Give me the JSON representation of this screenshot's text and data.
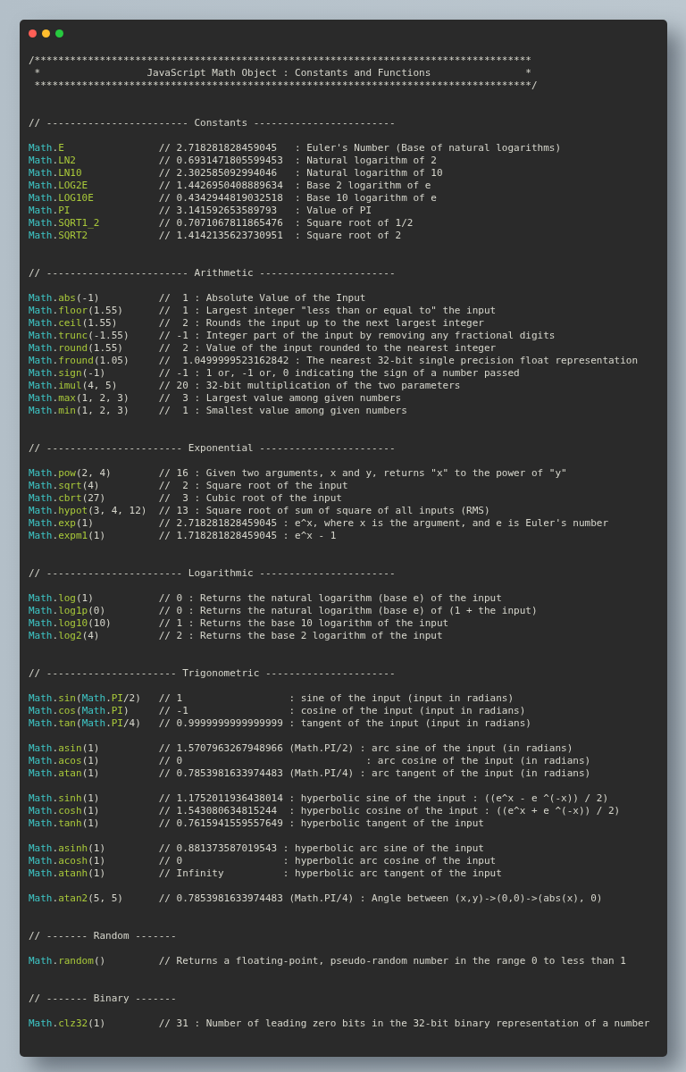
{
  "window": {
    "controls": [
      {
        "kind": "close"
      },
      {
        "kind": "minimize"
      },
      {
        "kind": "maximize"
      }
    ]
  },
  "header": [
    "/************************************************************************************",
    " *                  JavaScript Math Object : Constants and Functions                *",
    " ************************************************************************************/"
  ],
  "sections": [
    {
      "heading": "// ------------------------ Constants ------------------------",
      "groups": [
        [
          {
            "code": [
              {
                "kind": "object",
                "text": "Math"
              },
              {
                "kind": "plain",
                "text": "."
              },
              {
                "kind": "member",
                "text": "E"
              }
            ],
            "comment": "// 2.718281828459045   : Euler's Number (Base of natural logarithms)"
          },
          {
            "code": [
              {
                "kind": "object",
                "text": "Math"
              },
              {
                "kind": "plain",
                "text": "."
              },
              {
                "kind": "member",
                "text": "LN2"
              }
            ],
            "comment": "// 0.6931471805599453  : Natural logarithm of 2"
          },
          {
            "code": [
              {
                "kind": "object",
                "text": "Math"
              },
              {
                "kind": "plain",
                "text": "."
              },
              {
                "kind": "member",
                "text": "LN10"
              }
            ],
            "comment": "// 2.302585092994046   : Natural logarithm of 10"
          },
          {
            "code": [
              {
                "kind": "object",
                "text": "Math"
              },
              {
                "kind": "plain",
                "text": "."
              },
              {
                "kind": "member",
                "text": "LOG2E"
              }
            ],
            "comment": "// 1.4426950408889634  : Base 2 logarithm of e"
          },
          {
            "code": [
              {
                "kind": "object",
                "text": "Math"
              },
              {
                "kind": "plain",
                "text": "."
              },
              {
                "kind": "member",
                "text": "LOG10E"
              }
            ],
            "comment": "// 0.4342944819032518  : Base 10 logarithm of e"
          },
          {
            "code": [
              {
                "kind": "object",
                "text": "Math"
              },
              {
                "kind": "plain",
                "text": "."
              },
              {
                "kind": "member",
                "text": "PI"
              }
            ],
            "comment": "// 3.141592653589793   : Value of PI"
          },
          {
            "code": [
              {
                "kind": "object",
                "text": "Math"
              },
              {
                "kind": "plain",
                "text": "."
              },
              {
                "kind": "member",
                "text": "SQRT1_2"
              }
            ],
            "comment": "// 0.7071067811865476  : Square root of 1/2"
          },
          {
            "code": [
              {
                "kind": "object",
                "text": "Math"
              },
              {
                "kind": "plain",
                "text": "."
              },
              {
                "kind": "member",
                "text": "SQRT2"
              }
            ],
            "comment": "// 1.4142135623730951  : Square root of 2"
          }
        ]
      ]
    },
    {
      "heading": "// ------------------------ Arithmetic -----------------------",
      "groups": [
        [
          {
            "code": [
              {
                "kind": "object",
                "text": "Math"
              },
              {
                "kind": "plain",
                "text": "."
              },
              {
                "kind": "member",
                "text": "abs"
              },
              {
                "kind": "plain",
                "text": "(-1)"
              }
            ],
            "comment": "//  1 : Absolute Value of the Input"
          },
          {
            "code": [
              {
                "kind": "object",
                "text": "Math"
              },
              {
                "kind": "plain",
                "text": "."
              },
              {
                "kind": "member",
                "text": "floor"
              },
              {
                "kind": "plain",
                "text": "(1.55)"
              }
            ],
            "comment": "//  1 : Largest integer \"less than or equal to\" the input"
          },
          {
            "code": [
              {
                "kind": "object",
                "text": "Math"
              },
              {
                "kind": "plain",
                "text": "."
              },
              {
                "kind": "member",
                "text": "ceil"
              },
              {
                "kind": "plain",
                "text": "(1.55)"
              }
            ],
            "comment": "//  2 : Rounds the input up to the next largest integer"
          },
          {
            "code": [
              {
                "kind": "object",
                "text": "Math"
              },
              {
                "kind": "plain",
                "text": "."
              },
              {
                "kind": "member",
                "text": "trunc"
              },
              {
                "kind": "plain",
                "text": "(-1.55)"
              }
            ],
            "comment": "// -1 : Integer part of the input by removing any fractional digits"
          },
          {
            "code": [
              {
                "kind": "object",
                "text": "Math"
              },
              {
                "kind": "plain",
                "text": "."
              },
              {
                "kind": "member",
                "text": "round"
              },
              {
                "kind": "plain",
                "text": "(1.55)"
              }
            ],
            "comment": "//  2 : Value of the input rounded to the nearest integer"
          },
          {
            "code": [
              {
                "kind": "object",
                "text": "Math"
              },
              {
                "kind": "plain",
                "text": "."
              },
              {
                "kind": "member",
                "text": "fround"
              },
              {
                "kind": "plain",
                "text": "(1.05)"
              }
            ],
            "comment": "//  1.0499999523162842 : The nearest 32-bit single precision float representation"
          },
          {
            "code": [
              {
                "kind": "object",
                "text": "Math"
              },
              {
                "kind": "plain",
                "text": "."
              },
              {
                "kind": "member",
                "text": "sign"
              },
              {
                "kind": "plain",
                "text": "(-1)"
              }
            ],
            "comment": "// -1 : 1 or, -1 or, 0 indicating the sign of a number passed"
          },
          {
            "code": [
              {
                "kind": "object",
                "text": "Math"
              },
              {
                "kind": "plain",
                "text": "."
              },
              {
                "kind": "member",
                "text": "imul"
              },
              {
                "kind": "plain",
                "text": "(4, 5)"
              }
            ],
            "comment": "// 20 : 32-bit multiplication of the two parameters"
          },
          {
            "code": [
              {
                "kind": "object",
                "text": "Math"
              },
              {
                "kind": "plain",
                "text": "."
              },
              {
                "kind": "member",
                "text": "max"
              },
              {
                "kind": "plain",
                "text": "(1, 2, 3)"
              }
            ],
            "comment": "//  3 : Largest value among given numbers"
          },
          {
            "code": [
              {
                "kind": "object",
                "text": "Math"
              },
              {
                "kind": "plain",
                "text": "."
              },
              {
                "kind": "member",
                "text": "min"
              },
              {
                "kind": "plain",
                "text": "(1, 2, 3)"
              }
            ],
            "comment": "//  1 : Smallest value among given numbers"
          }
        ]
      ]
    },
    {
      "heading": "// ----------------------- Exponential -----------------------",
      "groups": [
        [
          {
            "code": [
              {
                "kind": "object",
                "text": "Math"
              },
              {
                "kind": "plain",
                "text": "."
              },
              {
                "kind": "member",
                "text": "pow"
              },
              {
                "kind": "plain",
                "text": "(2, 4)"
              }
            ],
            "comment": "// 16 : Given two arguments, x and y, returns \"x\" to the power of \"y\""
          },
          {
            "code": [
              {
                "kind": "object",
                "text": "Math"
              },
              {
                "kind": "plain",
                "text": "."
              },
              {
                "kind": "member",
                "text": "sqrt"
              },
              {
                "kind": "plain",
                "text": "(4)"
              }
            ],
            "comment": "//  2 : Square root of the input"
          },
          {
            "code": [
              {
                "kind": "object",
                "text": "Math"
              },
              {
                "kind": "plain",
                "text": "."
              },
              {
                "kind": "member",
                "text": "cbrt"
              },
              {
                "kind": "plain",
                "text": "(27)"
              }
            ],
            "comment": "//  3 : Cubic root of the input"
          },
          {
            "code": [
              {
                "kind": "object",
                "text": "Math"
              },
              {
                "kind": "plain",
                "text": "."
              },
              {
                "kind": "member",
                "text": "hypot"
              },
              {
                "kind": "plain",
                "text": "(3, 4, 12)"
              }
            ],
            "comment": "// 13 : Square root of sum of square of all inputs (RMS)"
          },
          {
            "code": [
              {
                "kind": "object",
                "text": "Math"
              },
              {
                "kind": "plain",
                "text": "."
              },
              {
                "kind": "member",
                "text": "exp"
              },
              {
                "kind": "plain",
                "text": "(1)"
              }
            ],
            "comment": "// 2.718281828459045 : e^x, where x is the argument, and e is Euler's number"
          },
          {
            "code": [
              {
                "kind": "object",
                "text": "Math"
              },
              {
                "kind": "plain",
                "text": "."
              },
              {
                "kind": "member",
                "text": "expm1"
              },
              {
                "kind": "plain",
                "text": "(1)"
              }
            ],
            "comment": "// 1.718281828459045 : e^x - 1"
          }
        ]
      ]
    },
    {
      "heading": "// ----------------------- Logarithmic -----------------------",
      "groups": [
        [
          {
            "code": [
              {
                "kind": "object",
                "text": "Math"
              },
              {
                "kind": "plain",
                "text": "."
              },
              {
                "kind": "member",
                "text": "log"
              },
              {
                "kind": "plain",
                "text": "(1)"
              }
            ],
            "comment": "// 0 : Returns the natural logarithm (base e) of the input"
          },
          {
            "code": [
              {
                "kind": "object",
                "text": "Math"
              },
              {
                "kind": "plain",
                "text": "."
              },
              {
                "kind": "member",
                "text": "log1p"
              },
              {
                "kind": "plain",
                "text": "(0)"
              }
            ],
            "comment": "// 0 : Returns the natural logarithm (base e) of (1 + the input)"
          },
          {
            "code": [
              {
                "kind": "object",
                "text": "Math"
              },
              {
                "kind": "plain",
                "text": "."
              },
              {
                "kind": "member",
                "text": "log10"
              },
              {
                "kind": "plain",
                "text": "(10)"
              }
            ],
            "comment": "// 1 : Returns the base 10 logarithm of the input"
          },
          {
            "code": [
              {
                "kind": "object",
                "text": "Math"
              },
              {
                "kind": "plain",
                "text": "."
              },
              {
                "kind": "member",
                "text": "log2"
              },
              {
                "kind": "plain",
                "text": "(4)"
              }
            ],
            "comment": "// 2 : Returns the base 2 logarithm of the input"
          }
        ]
      ]
    },
    {
      "heading": "// ---------------------- Trigonometric ----------------------",
      "groups": [
        [
          {
            "code": [
              {
                "kind": "object",
                "text": "Math"
              },
              {
                "kind": "plain",
                "text": "."
              },
              {
                "kind": "member",
                "text": "sin"
              },
              {
                "kind": "plain",
                "text": "("
              },
              {
                "kind": "object",
                "text": "Math"
              },
              {
                "kind": "plain",
                "text": "."
              },
              {
                "kind": "member",
                "text": "PI"
              },
              {
                "kind": "plain",
                "text": "/2)"
              }
            ],
            "comment": "// 1                  : sine of the input (input in radians)"
          },
          {
            "code": [
              {
                "kind": "object",
                "text": "Math"
              },
              {
                "kind": "plain",
                "text": "."
              },
              {
                "kind": "member",
                "text": "cos"
              },
              {
                "kind": "plain",
                "text": "("
              },
              {
                "kind": "object",
                "text": "Math"
              },
              {
                "kind": "plain",
                "text": "."
              },
              {
                "kind": "member",
                "text": "PI"
              },
              {
                "kind": "plain",
                "text": ")"
              }
            ],
            "comment": "// -1                 : cosine of the input (input in radians)"
          },
          {
            "code": [
              {
                "kind": "object",
                "text": "Math"
              },
              {
                "kind": "plain",
                "text": "."
              },
              {
                "kind": "member",
                "text": "tan"
              },
              {
                "kind": "plain",
                "text": "("
              },
              {
                "kind": "object",
                "text": "Math"
              },
              {
                "kind": "plain",
                "text": "."
              },
              {
                "kind": "member",
                "text": "PI"
              },
              {
                "kind": "plain",
                "text": "/4)"
              }
            ],
            "comment": "// 0.9999999999999999 : tangent of the input (input in radians)"
          }
        ],
        [
          {
            "code": [
              {
                "kind": "object",
                "text": "Math"
              },
              {
                "kind": "plain",
                "text": "."
              },
              {
                "kind": "member",
                "text": "asin"
              },
              {
                "kind": "plain",
                "text": "(1)"
              }
            ],
            "comment": "// 1.5707963267948966 (Math.PI/2) : arc sine of the input (in radians)"
          },
          {
            "code": [
              {
                "kind": "object",
                "text": "Math"
              },
              {
                "kind": "plain",
                "text": "."
              },
              {
                "kind": "member",
                "text": "acos"
              },
              {
                "kind": "plain",
                "text": "(1)"
              }
            ],
            "comment": "// 0                               : arc cosine of the input (in radians)"
          },
          {
            "code": [
              {
                "kind": "object",
                "text": "Math"
              },
              {
                "kind": "plain",
                "text": "."
              },
              {
                "kind": "member",
                "text": "atan"
              },
              {
                "kind": "plain",
                "text": "(1)"
              }
            ],
            "comment": "// 0.7853981633974483 (Math.PI/4) : arc tangent of the input (in radians)"
          }
        ],
        [
          {
            "code": [
              {
                "kind": "object",
                "text": "Math"
              },
              {
                "kind": "plain",
                "text": "."
              },
              {
                "kind": "member",
                "text": "sinh"
              },
              {
                "kind": "plain",
                "text": "(1)"
              }
            ],
            "comment": "// 1.1752011936438014 : hyperbolic sine of the input : ((e^x - e ^(-x)) / 2)"
          },
          {
            "code": [
              {
                "kind": "object",
                "text": "Math"
              },
              {
                "kind": "plain",
                "text": "."
              },
              {
                "kind": "member",
                "text": "cosh"
              },
              {
                "kind": "plain",
                "text": "(1)"
              }
            ],
            "comment": "// 1.543080634815244  : hyperbolic cosine of the input : ((e^x + e ^(-x)) / 2)"
          },
          {
            "code": [
              {
                "kind": "object",
                "text": "Math"
              },
              {
                "kind": "plain",
                "text": "."
              },
              {
                "kind": "member",
                "text": "tanh"
              },
              {
                "kind": "plain",
                "text": "(1)"
              }
            ],
            "comment": "// 0.7615941559557649 : hyperbolic tangent of the input"
          }
        ],
        [
          {
            "code": [
              {
                "kind": "object",
                "text": "Math"
              },
              {
                "kind": "plain",
                "text": "."
              },
              {
                "kind": "member",
                "text": "asinh"
              },
              {
                "kind": "plain",
                "text": "(1)"
              }
            ],
            "comment": "// 0.881373587019543 : hyperbolic arc sine of the input"
          },
          {
            "code": [
              {
                "kind": "object",
                "text": "Math"
              },
              {
                "kind": "plain",
                "text": "."
              },
              {
                "kind": "member",
                "text": "acosh"
              },
              {
                "kind": "plain",
                "text": "(1)"
              }
            ],
            "comment": "// 0                 : hyperbolic arc cosine of the input"
          },
          {
            "code": [
              {
                "kind": "object",
                "text": "Math"
              },
              {
                "kind": "plain",
                "text": "."
              },
              {
                "kind": "member",
                "text": "atanh"
              },
              {
                "kind": "plain",
                "text": "(1)"
              }
            ],
            "comment": "// Infinity          : hyperbolic arc tangent of the input"
          }
        ],
        [
          {
            "code": [
              {
                "kind": "object",
                "text": "Math"
              },
              {
                "kind": "plain",
                "text": "."
              },
              {
                "kind": "member",
                "text": "atan2"
              },
              {
                "kind": "plain",
                "text": "(5, 5)"
              }
            ],
            "comment": "// 0.7853981633974483 (Math.PI/4) : Angle between (x,y)->(0,0)->(abs(x), 0)"
          }
        ]
      ]
    },
    {
      "heading": "// ------- Random -------",
      "groups": [
        [
          {
            "code": [
              {
                "kind": "object",
                "text": "Math"
              },
              {
                "kind": "plain",
                "text": "."
              },
              {
                "kind": "member",
                "text": "random"
              },
              {
                "kind": "plain",
                "text": "()"
              }
            ],
            "comment": "// Returns a floating-point, pseudo-random number in the range 0 to less than 1"
          }
        ]
      ]
    },
    {
      "heading": "// ------- Binary -------",
      "groups": [
        [
          {
            "code": [
              {
                "kind": "object",
                "text": "Math"
              },
              {
                "kind": "plain",
                "text": "."
              },
              {
                "kind": "member",
                "text": "clz32"
              },
              {
                "kind": "plain",
                "text": "(1)"
              }
            ],
            "comment": "// 31 : Number of leading zero bits in the 32-bit binary representation of a number"
          }
        ]
      ]
    }
  ]
}
